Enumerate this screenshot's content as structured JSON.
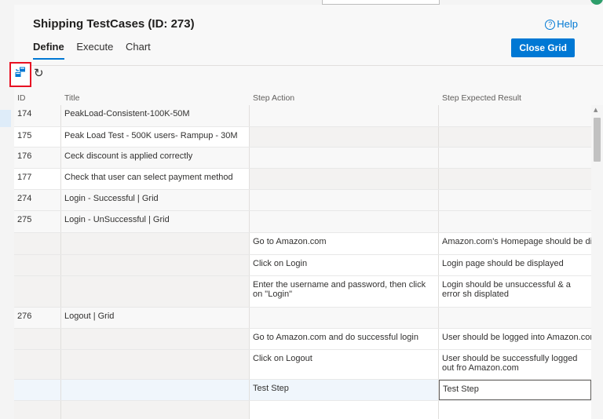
{
  "header": {
    "title": "Shipping TestCases (ID: 273)",
    "help_label": "Help",
    "help_glyph": "?",
    "close_grid_label": "Close Grid"
  },
  "tabs": [
    {
      "label": "Define",
      "active": true
    },
    {
      "label": "Execute",
      "active": false
    },
    {
      "label": "Chart",
      "active": false
    }
  ],
  "toolbar": {
    "icons": [
      "grid-toggle-icon",
      "refresh-icon"
    ],
    "refresh_glyph": "↻"
  },
  "grid": {
    "columns": [
      "ID",
      "Title",
      "Step Action",
      "Step Expected Result"
    ],
    "rows": [
      {
        "id": "174",
        "title": "PeakLoad-Consistent-100K-50M",
        "step": "",
        "expected": ""
      },
      {
        "id": "175",
        "title": "Peak Load Test - 500K users- Rampup - 30M",
        "step": "",
        "expected": ""
      },
      {
        "id": "176",
        "title": " Ceck discount is applied correctly",
        "step": "",
        "expected": ""
      },
      {
        "id": "177",
        "title": "Check that user can select payment method",
        "step": "",
        "expected": ""
      },
      {
        "id": "274",
        "title": "Login - Successful  | Grid",
        "step": "",
        "expected": ""
      },
      {
        "id": "275",
        "title": "Login - UnSuccessful | Grid",
        "step": "",
        "expected": ""
      },
      {
        "id": "",
        "title": "",
        "step": "Go to Amazon.com",
        "expected": "Amazon.com's Homepage should be disp"
      },
      {
        "id": "",
        "title": "",
        "step": "Click on Login",
        "expected": "Login page should be displayed"
      },
      {
        "id": "",
        "title": "",
        "step": "Enter the username and password, then click on \"Login\"",
        "expected": "Login should be unsuccessful & a error sh displated"
      },
      {
        "id": "276",
        "title": "Logout | Grid",
        "step": "",
        "expected": ""
      },
      {
        "id": "",
        "title": "",
        "step": "Go to Amazon.com and do successful login",
        "expected": "User should be logged into Amazon.com"
      },
      {
        "id": "",
        "title": "",
        "step": "Click on Logout",
        "expected": "User should be successfully logged out fro Amazon.com"
      },
      {
        "id": "",
        "title": "",
        "step": "Test Step",
        "expected": "Test Step"
      },
      {
        "id": "",
        "title": "",
        "step": "",
        "expected": ""
      }
    ]
  },
  "colors": {
    "accent": "#0078d4",
    "highlight_border": "#e81123"
  }
}
